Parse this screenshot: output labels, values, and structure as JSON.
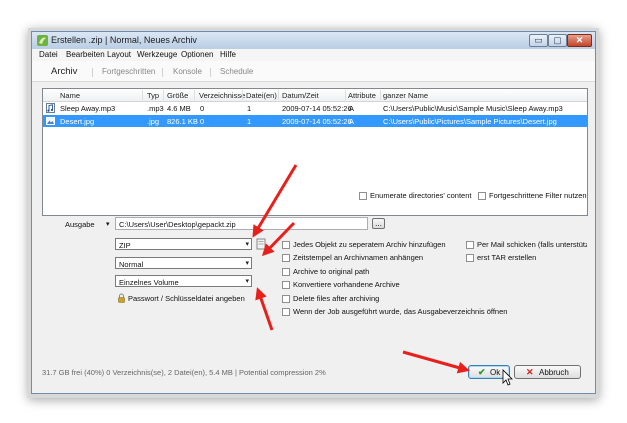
{
  "window": {
    "title": "Erstellen .zip | Normal, Neues Archiv"
  },
  "titlebar_buttons": {
    "minimize": "▭",
    "maximize": "▢",
    "close": "✕"
  },
  "menu": [
    "Datei",
    "Bearbeiten",
    "Layout",
    "Werkzeuge",
    "Optionen",
    "Hilfe"
  ],
  "tabs": {
    "active": "Archiv",
    "others": [
      "Fortgeschritten",
      "Konsole",
      "Schedule"
    ]
  },
  "file_list": {
    "columns": [
      "Name",
      "Typ",
      "Größe",
      "Verzeichnisse",
      "Datei(en)",
      "Datum/Zeit",
      "Attribute",
      "ganzer Name"
    ],
    "rows": [
      {
        "name": "Sleep Away.mp3",
        "type": ".mp3",
        "size": "4.6 MB",
        "dirs": "0",
        "files": "1",
        "date": "2009-07-14 05:52:26",
        "attr": "A",
        "full": "C:\\Users\\Public\\Music\\Sample Music\\Sleep Away.mp3",
        "icon": "audio-file-icon"
      },
      {
        "name": "Desert.jpg",
        "type": ".jpg",
        "size": "826.1 KB",
        "dirs": "0",
        "files": "1",
        "date": "2009-07-14 05:52:26",
        "attr": "A",
        "full": "C:\\Users\\Public\\Pictures\\Sample Pictures\\Desert.jpg",
        "icon": "image-file-icon"
      }
    ],
    "selected_index": 1
  },
  "filters": {
    "enumerate": "Enumerate directories' content",
    "advanced": "Fortgeschrittene Filter nutzen"
  },
  "output": {
    "label": "Ausgabe",
    "dropdown_glyph": "▾",
    "path": "C:\\Users\\User\\Desktop\\gepackt.zip",
    "browse": "..."
  },
  "combos": {
    "format": "ZIP",
    "level": "Normal",
    "volume": "Einzelnes Volume",
    "arrow": "▾"
  },
  "password_link": "Passwort / Schlüsseldatei angeben",
  "options": [
    "Jedes Objekt zu seperatem Archiv hinzufügen",
    "Zeitstempel an Archivnamen anhängen",
    "Archive to original path",
    "Konvertiere vorhandene Archive",
    "Delete files after archiving",
    "Wenn der Job ausgeführt wurde, das Ausgabeverzeichnis öffnen"
  ],
  "right_options": [
    "Per Mail schicken (falls unterstützt)",
    "erst TAR erstellen"
  ],
  "status": "31.7 GB frei (40%)   0 Verzeichnis(se), 2 Datei(en), 5.4 MB | Potential compression 2%",
  "buttons": {
    "ok": "Ok",
    "ok_icon": "✔",
    "cancel": "Abbruch",
    "cancel_icon": "✕"
  },
  "colors": {
    "selection": "#3399ff",
    "arrow": "#e8201c",
    "ok_check": "#2a9a2a",
    "cancel_x": "#d42020"
  }
}
